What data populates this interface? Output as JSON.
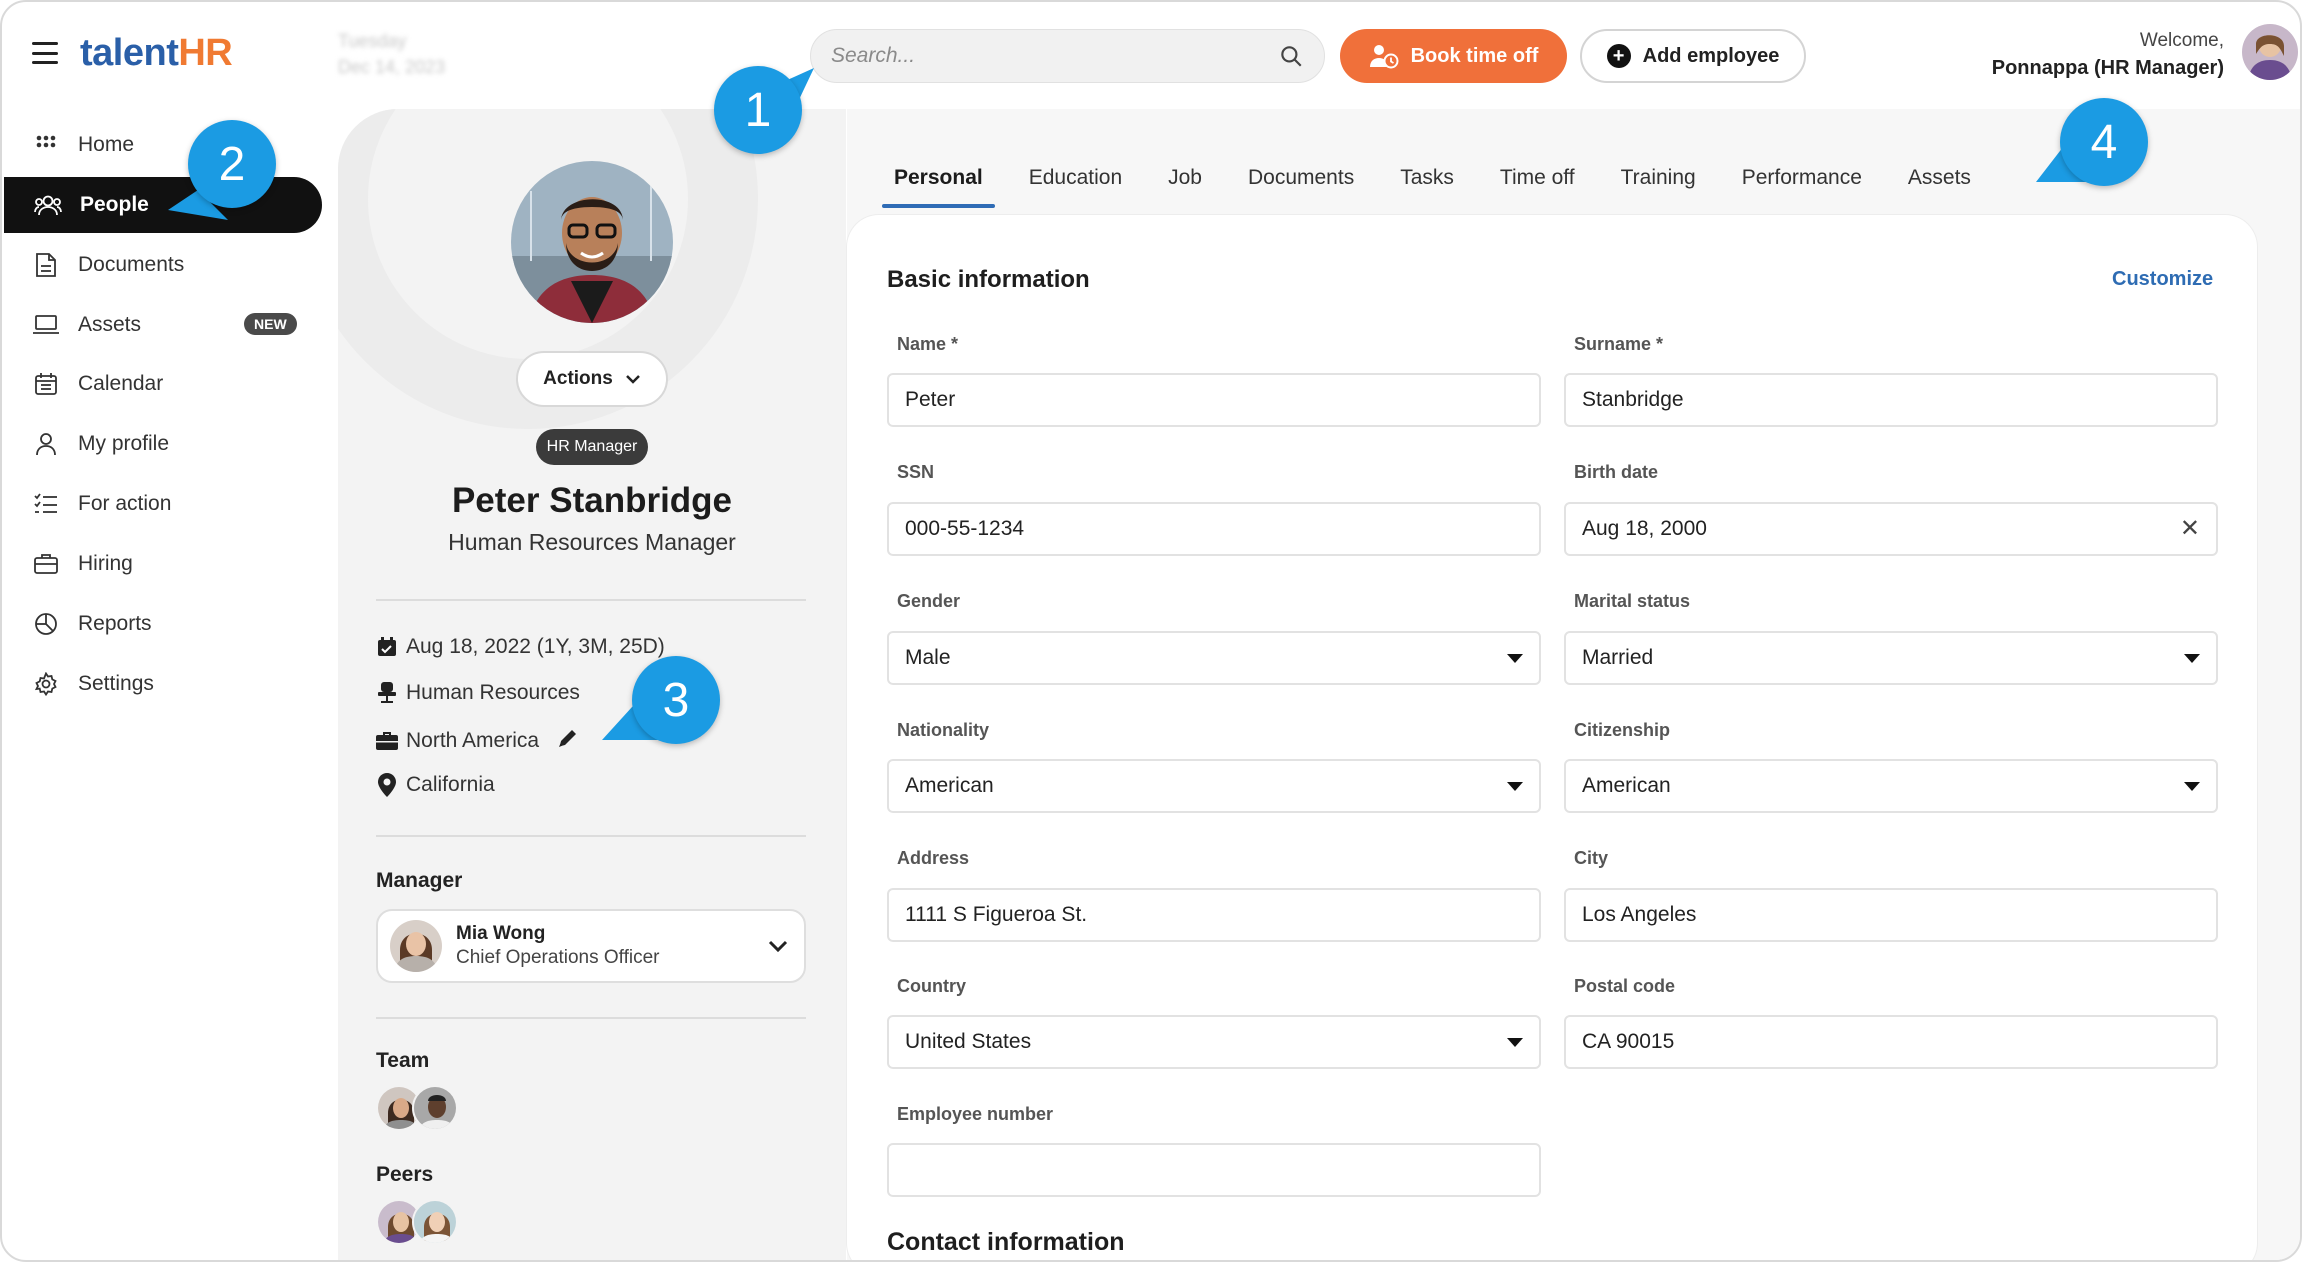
{
  "app": {
    "logo_part1": "talent",
    "logo_part2": "HR",
    "date_blurred": "Tuesday",
    "date_blurred2": "Dec 14, 2023"
  },
  "search": {
    "placeholder": "Search..."
  },
  "topbar": {
    "book_label": "Book time off",
    "add_label": "Add employee",
    "welcome": "Welcome,",
    "user": "Ponnappa (HR Manager)"
  },
  "sidebar": {
    "items": [
      {
        "label": "Home",
        "icon": "grid-icon"
      },
      {
        "label": "People",
        "icon": "people-icon"
      },
      {
        "label": "Documents",
        "icon": "document-icon"
      },
      {
        "label": "Assets",
        "icon": "laptop-icon",
        "badge": "NEW"
      },
      {
        "label": "Calendar",
        "icon": "calendar-icon"
      },
      {
        "label": "My profile",
        "icon": "user-icon"
      },
      {
        "label": "For action",
        "icon": "checklist-icon"
      },
      {
        "label": "Hiring",
        "icon": "briefcase-icon"
      },
      {
        "label": "Reports",
        "icon": "pie-chart-icon"
      },
      {
        "label": "Settings",
        "icon": "gear-icon"
      }
    ]
  },
  "profile": {
    "actions_label": "Actions",
    "role_badge": "HR Manager",
    "name": "Peter Stanbridge",
    "title": "Human Resources Manager",
    "start_date": "Aug 18, 2022 (1Y, 3M, 25D)",
    "department": "Human Resources",
    "region": "North America",
    "location": "California",
    "manager_label": "Manager",
    "manager_name": "Mia Wong",
    "manager_role": "Chief Operations Officer",
    "team_label": "Team",
    "peers_label": "Peers"
  },
  "tabs": [
    "Personal",
    "Education",
    "Job",
    "Documents",
    "Tasks",
    "Time off",
    "Training",
    "Performance",
    "Assets"
  ],
  "form": {
    "title": "Basic information",
    "customize": "Customize",
    "name_label": "Name *",
    "name_value": "Peter",
    "surname_label": "Surname *",
    "surname_value": "Stanbridge",
    "ssn_label": "SSN",
    "ssn_value": "000-55-1234",
    "birth_label": "Birth date",
    "birth_value": "Aug 18, 2000",
    "gender_label": "Gender",
    "gender_value": "Male",
    "marital_label": "Marital status",
    "marital_value": "Married",
    "nationality_label": "Nationality",
    "nationality_value": "American",
    "citizenship_label": "Citizenship",
    "citizenship_value": "American",
    "address_label": "Address",
    "address_value": "1111 S Figueroa St.",
    "city_label": "City",
    "city_value": "Los Angeles",
    "country_label": "Country",
    "country_value": "United States",
    "postal_label": "Postal code",
    "postal_value": "CA 90015",
    "empno_label": "Employee number",
    "empno_value": "",
    "contact_title": "Contact information"
  },
  "callouts": [
    "1",
    "2",
    "3",
    "4"
  ],
  "colors": {
    "accent_orange": "#f0703a",
    "accent_blue": "#2f6cb6",
    "callout_blue": "#1b9be3",
    "logo_blue": "#2a5fa8"
  }
}
